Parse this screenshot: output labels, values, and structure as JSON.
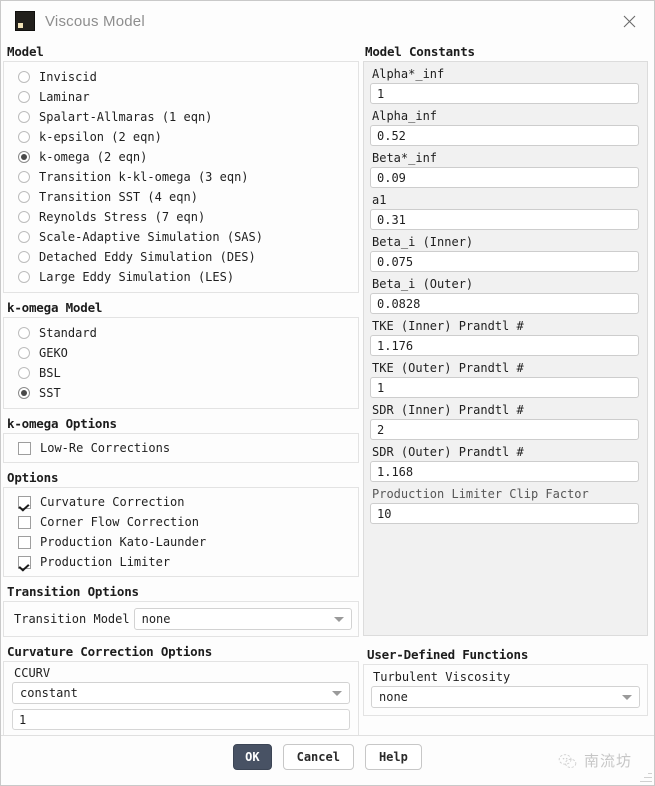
{
  "window": {
    "title": "Viscous Model",
    "app_icon": "fluent-app-icon",
    "close_icon": "close-icon"
  },
  "model_group": {
    "title": "Model",
    "selected": "k-omega (2 eqn)",
    "items": [
      {
        "label": "Inviscid",
        "selected": false
      },
      {
        "label": "Laminar",
        "selected": false
      },
      {
        "label": "Spalart-Allmaras (1 eqn)",
        "selected": false
      },
      {
        "label": "k-epsilon (2 eqn)",
        "selected": false
      },
      {
        "label": "k-omega (2 eqn)",
        "selected": true
      },
      {
        "label": "Transition k-kl-omega (3 eqn)",
        "selected": false
      },
      {
        "label": "Transition SST (4 eqn)",
        "selected": false
      },
      {
        "label": "Reynolds Stress (7 eqn)",
        "selected": false
      },
      {
        "label": "Scale-Adaptive Simulation (SAS)",
        "selected": false
      },
      {
        "label": "Detached Eddy Simulation (DES)",
        "selected": false
      },
      {
        "label": "Large Eddy Simulation (LES)",
        "selected": false
      }
    ]
  },
  "komega_model_group": {
    "title": "k-omega Model",
    "selected": "SST",
    "items": [
      {
        "label": "Standard",
        "selected": false
      },
      {
        "label": "GEKO",
        "selected": false
      },
      {
        "label": "BSL",
        "selected": false
      },
      {
        "label": "SST",
        "selected": true
      }
    ]
  },
  "komega_options_group": {
    "title": "k-omega Options",
    "items": [
      {
        "label": "Low-Re Corrections",
        "checked": false
      }
    ]
  },
  "options_group": {
    "title": "Options",
    "items": [
      {
        "label": "Curvature Correction",
        "checked": true
      },
      {
        "label": "Corner Flow Correction",
        "checked": false
      },
      {
        "label": "Production Kato-Launder",
        "checked": false
      },
      {
        "label": "Production Limiter",
        "checked": true
      }
    ]
  },
  "transition_options_group": {
    "title": "Transition Options",
    "transition_model": {
      "label": "Transition Model",
      "value": "none",
      "options": [
        "none"
      ],
      "caret_icon": "chevron-down-icon"
    }
  },
  "curvature_correction_group": {
    "title": "Curvature Correction Options",
    "ccurv": {
      "label": "CCURV",
      "mode_value": "constant",
      "mode_options": [
        "constant"
      ],
      "value": "1",
      "caret_icon": "chevron-down-icon"
    }
  },
  "model_constants": {
    "title": "Model Constants",
    "fields": [
      {
        "label": "Alpha*_inf",
        "value": "1",
        "dim": false
      },
      {
        "label": "Alpha_inf",
        "value": "0.52",
        "dim": false
      },
      {
        "label": "Beta*_inf",
        "value": "0.09",
        "dim": false
      },
      {
        "label": "a1",
        "value": "0.31",
        "dim": false
      },
      {
        "label": "Beta_i (Inner)",
        "value": "0.075",
        "dim": false
      },
      {
        "label": "Beta_i (Outer)",
        "value": "0.0828",
        "dim": false
      },
      {
        "label": "TKE (Inner) Prandtl #",
        "value": "1.176",
        "dim": false
      },
      {
        "label": "TKE (Outer) Prandtl #",
        "value": "1",
        "dim": false
      },
      {
        "label": "SDR (Inner) Prandtl #",
        "value": "2",
        "dim": false
      },
      {
        "label": "SDR (Outer) Prandtl #",
        "value": "1.168",
        "dim": false
      },
      {
        "label": "Production Limiter Clip Factor",
        "value": "10",
        "dim": true
      }
    ]
  },
  "udf": {
    "title": "User-Defined Functions",
    "turbulent_viscosity": {
      "label": "Turbulent Viscosity",
      "value": "none",
      "options": [
        "none"
      ],
      "caret_icon": "chevron-down-icon"
    }
  },
  "footer": {
    "ok_label": "OK",
    "cancel_label": "Cancel",
    "help_label": "Help",
    "watermark_text": "南流坊",
    "watermark_icon": "wechat-logo-icon"
  },
  "colors": {
    "primary_button": "#485264",
    "panel_background": "#f1f1f1",
    "dialog_background": "#fdfdfd",
    "title_text": "#8e8e8e"
  }
}
